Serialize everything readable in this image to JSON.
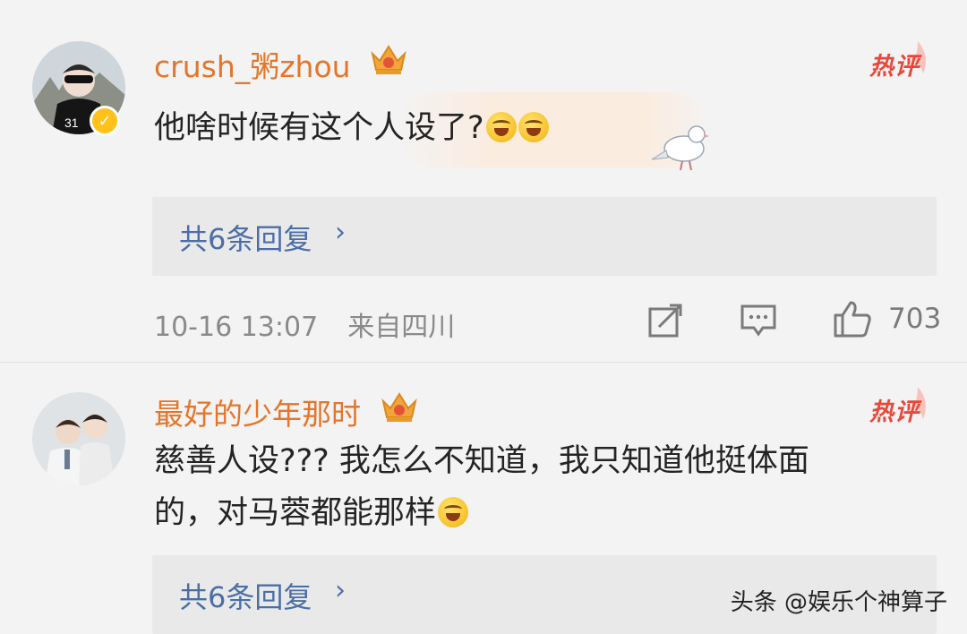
{
  "comments": [
    {
      "username": "crush_粥zhou",
      "badge": "hot",
      "hot_label": "热评",
      "text": "他啥时候有这个人设了?",
      "emojis": [
        "laugh-cry-emoji",
        "laugh-cry-emoji"
      ],
      "verified_icon": "v-badge",
      "replies_label": "共6条回复",
      "time": "10-16 13:07",
      "location": "来自四川",
      "likes": "703"
    },
    {
      "username": "最好的少年那时",
      "badge": "hot",
      "hot_label": "热评",
      "text_line1": "慈善人设??? 我怎么不知道，我只知道他挺体面",
      "text_line2": "的，对马蓉都能那样",
      "emojis": [
        "laugh-cry-emoji"
      ],
      "replies_label": "共6条回复"
    }
  ],
  "watermark": "头条 @娱乐个神算子",
  "colors": {
    "username": "#e3762a",
    "hot": "#e8483a",
    "link": "#4b6ea6",
    "background": "#f3f3f3"
  }
}
